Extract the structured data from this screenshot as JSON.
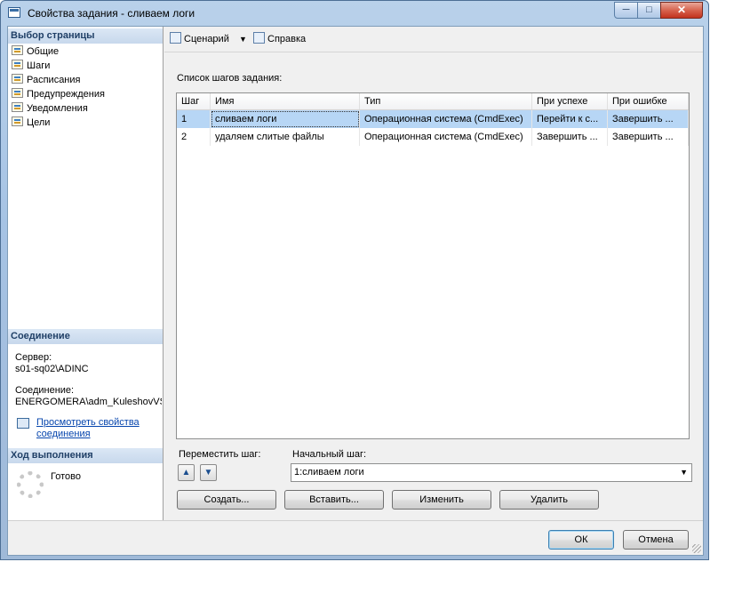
{
  "window": {
    "title": "Свойства задания - сливаем логи",
    "minimize": "─",
    "maximize": "□",
    "close": "✕"
  },
  "sidebar": {
    "select_page_header": "Выбор страницы",
    "items": [
      {
        "label": "Общие",
        "icon": "page-icon"
      },
      {
        "label": "Шаги",
        "icon": "page-icon"
      },
      {
        "label": "Расписания",
        "icon": "page-icon"
      },
      {
        "label": "Предупреждения",
        "icon": "page-icon"
      },
      {
        "label": "Уведомления",
        "icon": "page-icon"
      },
      {
        "label": "Цели",
        "icon": "page-icon"
      }
    ],
    "connection_header": "Соединение",
    "server_label": "Сервер:",
    "server_value": "s01-sq02\\ADINC",
    "connection_label": "Соединение:",
    "connection_value": "ENERGOMERA\\adm_KuleshovVS",
    "view_link_line1": "Просмотреть свойства",
    "view_link_line2": "соединения",
    "progress_header": "Ход выполнения",
    "progress_status": "Готово"
  },
  "toolbar": {
    "script_label": "Сценарий",
    "help_label": "Справка",
    "dropdown": "▼"
  },
  "steps": {
    "caption": "Список шагов задания:",
    "columns": [
      "Шаг",
      "Имя",
      "Тип",
      "При успехе",
      "При ошибке"
    ],
    "rows": [
      {
        "step": "1",
        "name": "сливаем логи",
        "type": "Операционная система (CmdExec)",
        "on_success": "Перейти к с...",
        "on_failure": "Завершить ..."
      },
      {
        "step": "2",
        "name": "удаляем слитые файлы",
        "type": "Операционная система (CmdExec)",
        "on_success": "Завершить ...",
        "on_failure": "Завершить ..."
      }
    ],
    "selected_row": 0
  },
  "controls": {
    "move_step_label": "Переместить шаг:",
    "up_arrow": "▲",
    "down_arrow": "▼",
    "start_step_label": "Начальный шаг:",
    "start_step_value": "1:сливаем логи",
    "combo_arrow": "▼",
    "new_button": "Создать...",
    "insert_button": "Вставить...",
    "edit_button": "Изменить",
    "delete_button": "Удалить"
  },
  "footer": {
    "ok_button": "ОК",
    "cancel_button": "Отмена"
  }
}
